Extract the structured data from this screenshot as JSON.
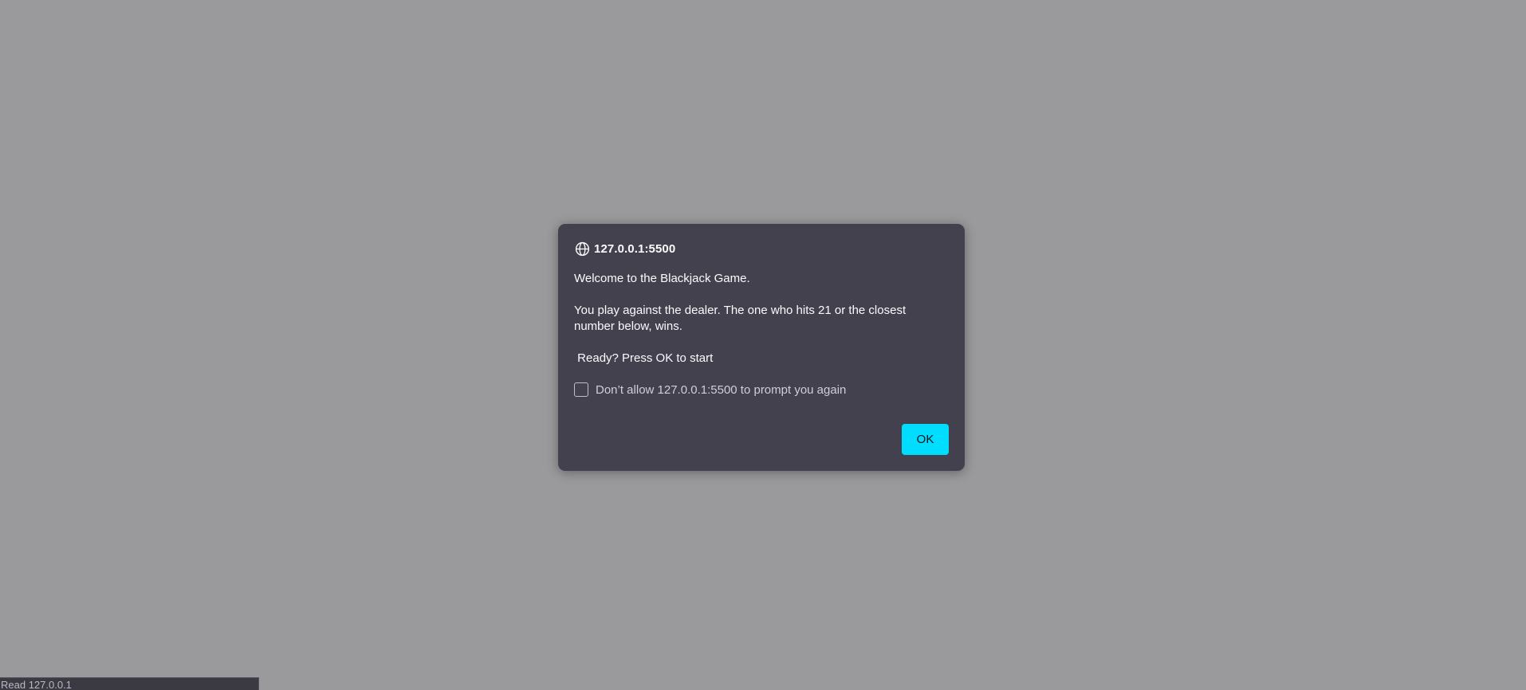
{
  "dialog": {
    "origin": "127.0.0.1:5500",
    "message": "Welcome to the Blackjack Game.\n\nYou play against the dealer. The one who hits 21 or the closest number below, wins.\n\n Ready? Press OK to start",
    "checkbox_label": "Don’t allow 127.0.0.1:5500 to prompt you again",
    "checkbox_checked": false,
    "ok_label": "OK",
    "header_icon": "globe-icon"
  },
  "status_bar": {
    "text": "Read 127.0.0.1"
  },
  "colors": {
    "backdrop": "#9a9a9c",
    "dialog_bg": "#42414d",
    "accent": "#00ddff",
    "text": "#fbfbfe"
  }
}
